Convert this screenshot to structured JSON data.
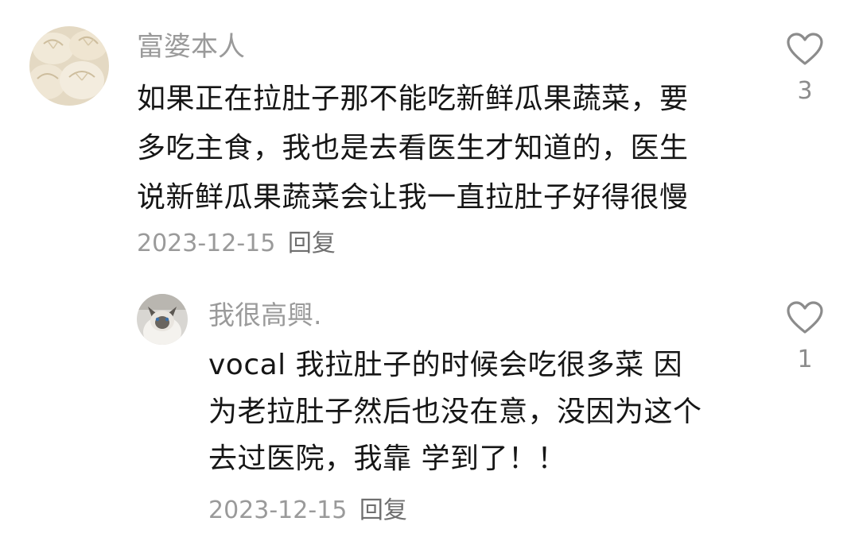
{
  "comments": [
    {
      "username": "富婆本人",
      "avatar": "dumpling-avatar",
      "lines": [
        "如果正在拉肚子那不能吃新鲜瓜果蔬菜，要",
        "多吃主食，我也是去看医生才知道的，医生",
        "说新鲜瓜果蔬菜会让我一直拉肚子好得很慢"
      ],
      "date": "2023-12-15",
      "reply_label": "回复",
      "likes": "3",
      "like_icon": "heart-icon"
    },
    {
      "username": "我很高興.",
      "avatar": "cat-avatar",
      "lines": [
        "vocal  我拉肚子的时候会吃很多菜  因",
        "为老拉肚子然后也没在意，没因为这个",
        "去过医院，我靠  学到了！！"
      ],
      "date": "2023-12-15",
      "reply_label": "回复",
      "likes": "1",
      "like_icon": "heart-icon"
    }
  ],
  "colors": {
    "text": "#161616",
    "muted": "#9a9a9a",
    "background": "#ffffff"
  }
}
